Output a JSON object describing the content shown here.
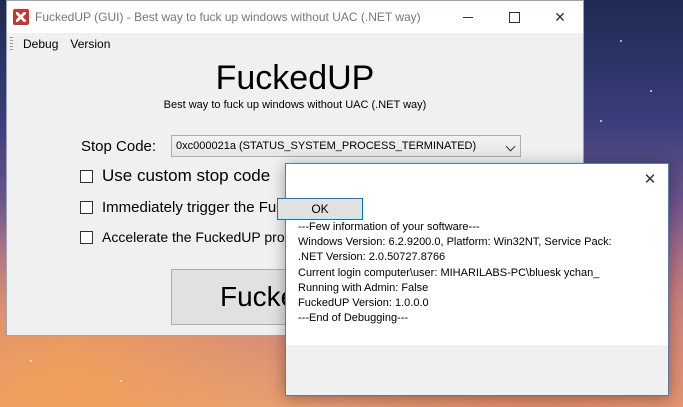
{
  "main_window": {
    "title": "FuckedUP (GUI) - Best way to fuck up windows without UAC (.NET way)",
    "controls": {
      "close": "✕"
    },
    "menu": [
      "Debug",
      "Version"
    ],
    "heading": "FuckedUP",
    "subheading": "Best way to fuck up windows without UAC (.NET way)",
    "stop_code_label": "Stop Code:",
    "stop_code_value": "0xc000021a (STATUS_SYSTEM_PROCESS_TERMINATED)",
    "options": [
      "Use custom stop code",
      "Immediately trigger the Fuc",
      "Accelerate the FuckedUP pro"
    ],
    "big_button_label": "Fucke"
  },
  "dialog": {
    "close": "✕",
    "lines": [
      "---Few information of your software---",
      "Windows Version: 6.2.9200.0, Platform: Win32NT, Service Pack:",
      ".NET Version: 2.0.50727.8766",
      "Current login computer\\user: MIHARILABS-PC\\bluesk ychan_",
      "Running with Admin: False",
      "FuckedUP Version: 1.0.0.0",
      "---End of Debugging---"
    ],
    "ok_label": "OK"
  }
}
